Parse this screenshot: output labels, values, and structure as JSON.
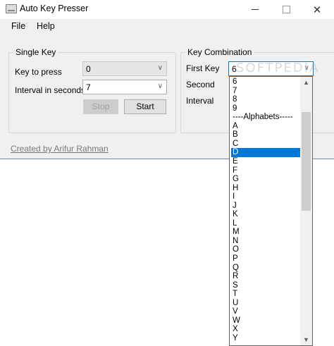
{
  "window": {
    "title": "Auto Key Presser"
  },
  "menu": {
    "file": "File",
    "help": "Help"
  },
  "single_key": {
    "title": "Single Key",
    "key_label": "Key to press",
    "key_value": "0",
    "interval_label": "Interval in seconds",
    "interval_value": "7",
    "stop_label": "Stop",
    "start_label": "Start"
  },
  "key_combination": {
    "title": "Key Combination",
    "first_key_label": "First Key",
    "first_key_value": "6",
    "second_label": "Second",
    "interval_label": "Interval"
  },
  "footer": {
    "credit": "Created by Arifur Rahman"
  },
  "watermark": "SOFTPEDIA",
  "dropdown": {
    "items": [
      "6",
      "7",
      "8",
      "9",
      "----Alphabets-----",
      "A",
      "B",
      "C",
      "D",
      "E",
      "F",
      "G",
      "H",
      "I",
      "J",
      "K",
      "L",
      "M",
      "N",
      "O",
      "P",
      "Q",
      "R",
      "S",
      "T",
      "U",
      "V",
      "W",
      "X",
      "Y"
    ],
    "selected": "D"
  },
  "colors": {
    "selection": "#0078d7",
    "window_bg": "#f0f0f0"
  }
}
